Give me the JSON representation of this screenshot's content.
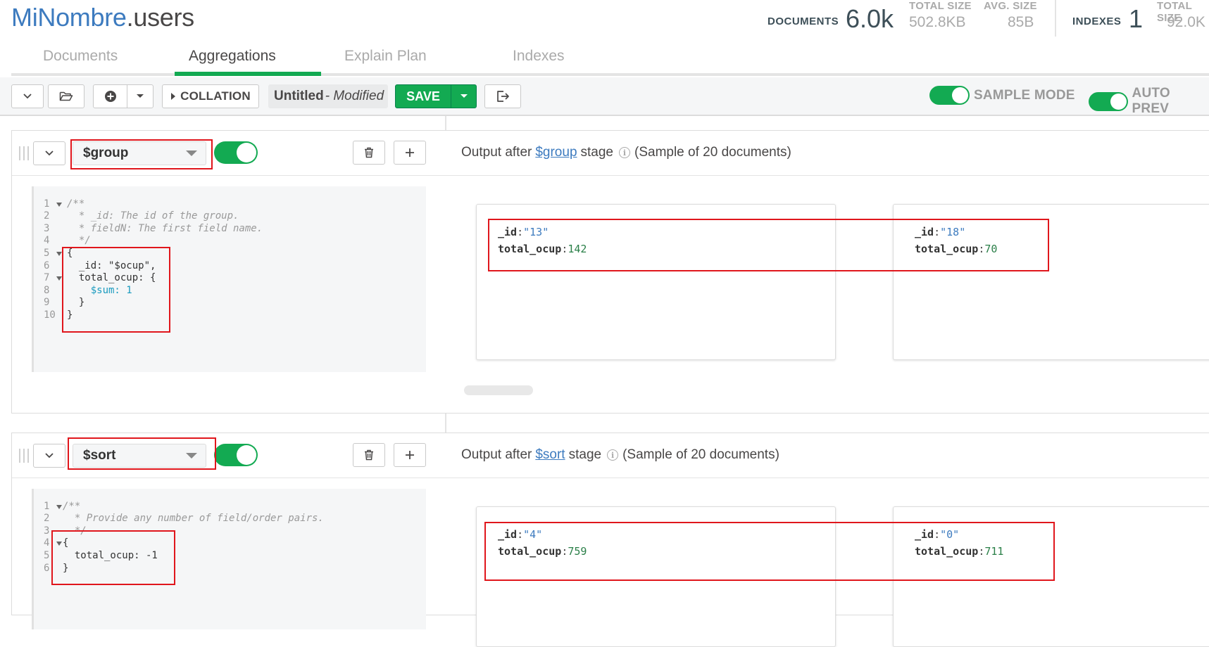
{
  "header": {
    "db": "MiNombre",
    "collection": ".users",
    "stats": {
      "documents_label": "DOCUMENTS",
      "documents_value": "6.0k",
      "total_size_label": "TOTAL SIZE",
      "total_size_value": "502.8KB",
      "avg_size_label": "AVG. SIZE",
      "avg_size_value": "85B",
      "indexes_label": "INDEXES",
      "indexes_value": "1",
      "index_total_size_label": "TOTAL SIZE",
      "index_total_size_value": "92.0K"
    },
    "tabs": [
      "Documents",
      "Aggregations",
      "Explain Plan",
      "Indexes"
    ],
    "active_tab": "Aggregations"
  },
  "toolbar": {
    "collation_label": "COLLATION",
    "pipeline_name": "Untitled",
    "pipeline_modified": "- Modified",
    "save_label": "SAVE",
    "sample_mode_label": "SAMPLE MODE",
    "auto_preview_label": "AUTO PREV"
  },
  "stages": [
    {
      "operator": "$group",
      "enabled": true,
      "output_prefix": "Output after",
      "output_link": "$group",
      "output_suffix": "stage",
      "sample_text": "(Sample of 20 documents)",
      "code": [
        {
          "n": "1",
          "fold": true,
          "text": "/**"
        },
        {
          "n": "2",
          "fold": false,
          "text": "  * _id: The id of the group."
        },
        {
          "n": "3",
          "fold": false,
          "text": "  * fieldN: The first field name."
        },
        {
          "n": "4",
          "fold": false,
          "text": "  */"
        },
        {
          "n": "5",
          "fold": true,
          "text": "{"
        },
        {
          "n": "6",
          "fold": false,
          "text": "  _id: \"$ocup\","
        },
        {
          "n": "7",
          "fold": true,
          "text": "  total_ocup: {"
        },
        {
          "n": "8",
          "fold": false,
          "text": "    $sum: 1"
        },
        {
          "n": "9",
          "fold": false,
          "text": "  }"
        },
        {
          "n": "10",
          "fold": false,
          "text": "}"
        }
      ],
      "documents": [
        {
          "id_key": "_id",
          "id_value": "\"13\"",
          "field_key": "total_ocup",
          "field_value": "142"
        },
        {
          "id_key": "_id",
          "id_value": "\"18\"",
          "field_key": "total_ocup",
          "field_value": "70"
        }
      ]
    },
    {
      "operator": "$sort",
      "enabled": true,
      "output_prefix": "Output after",
      "output_link": "$sort",
      "output_suffix": "stage",
      "sample_text": "(Sample of 20 documents)",
      "code": [
        {
          "n": "1",
          "fold": true,
          "text": "/**"
        },
        {
          "n": "2",
          "fold": false,
          "text": "  * Provide any number of field/order pairs."
        },
        {
          "n": "3",
          "fold": false,
          "text": "  */"
        },
        {
          "n": "4",
          "fold": true,
          "text": "{"
        },
        {
          "n": "5",
          "fold": false,
          "text": "  total_ocup: -1"
        },
        {
          "n": "6",
          "fold": false,
          "text": "}"
        }
      ],
      "documents": [
        {
          "id_key": "_id",
          "id_value": "\"4\"",
          "field_key": "total_ocup",
          "field_value": "759"
        },
        {
          "id_key": "_id",
          "id_value": "\"0\"",
          "field_key": "total_ocup",
          "field_value": "711"
        }
      ]
    }
  ],
  "colors": {
    "accent_green": "#13aa52",
    "link_blue": "#3d7bbf",
    "annotation_red": "#e0161c"
  }
}
